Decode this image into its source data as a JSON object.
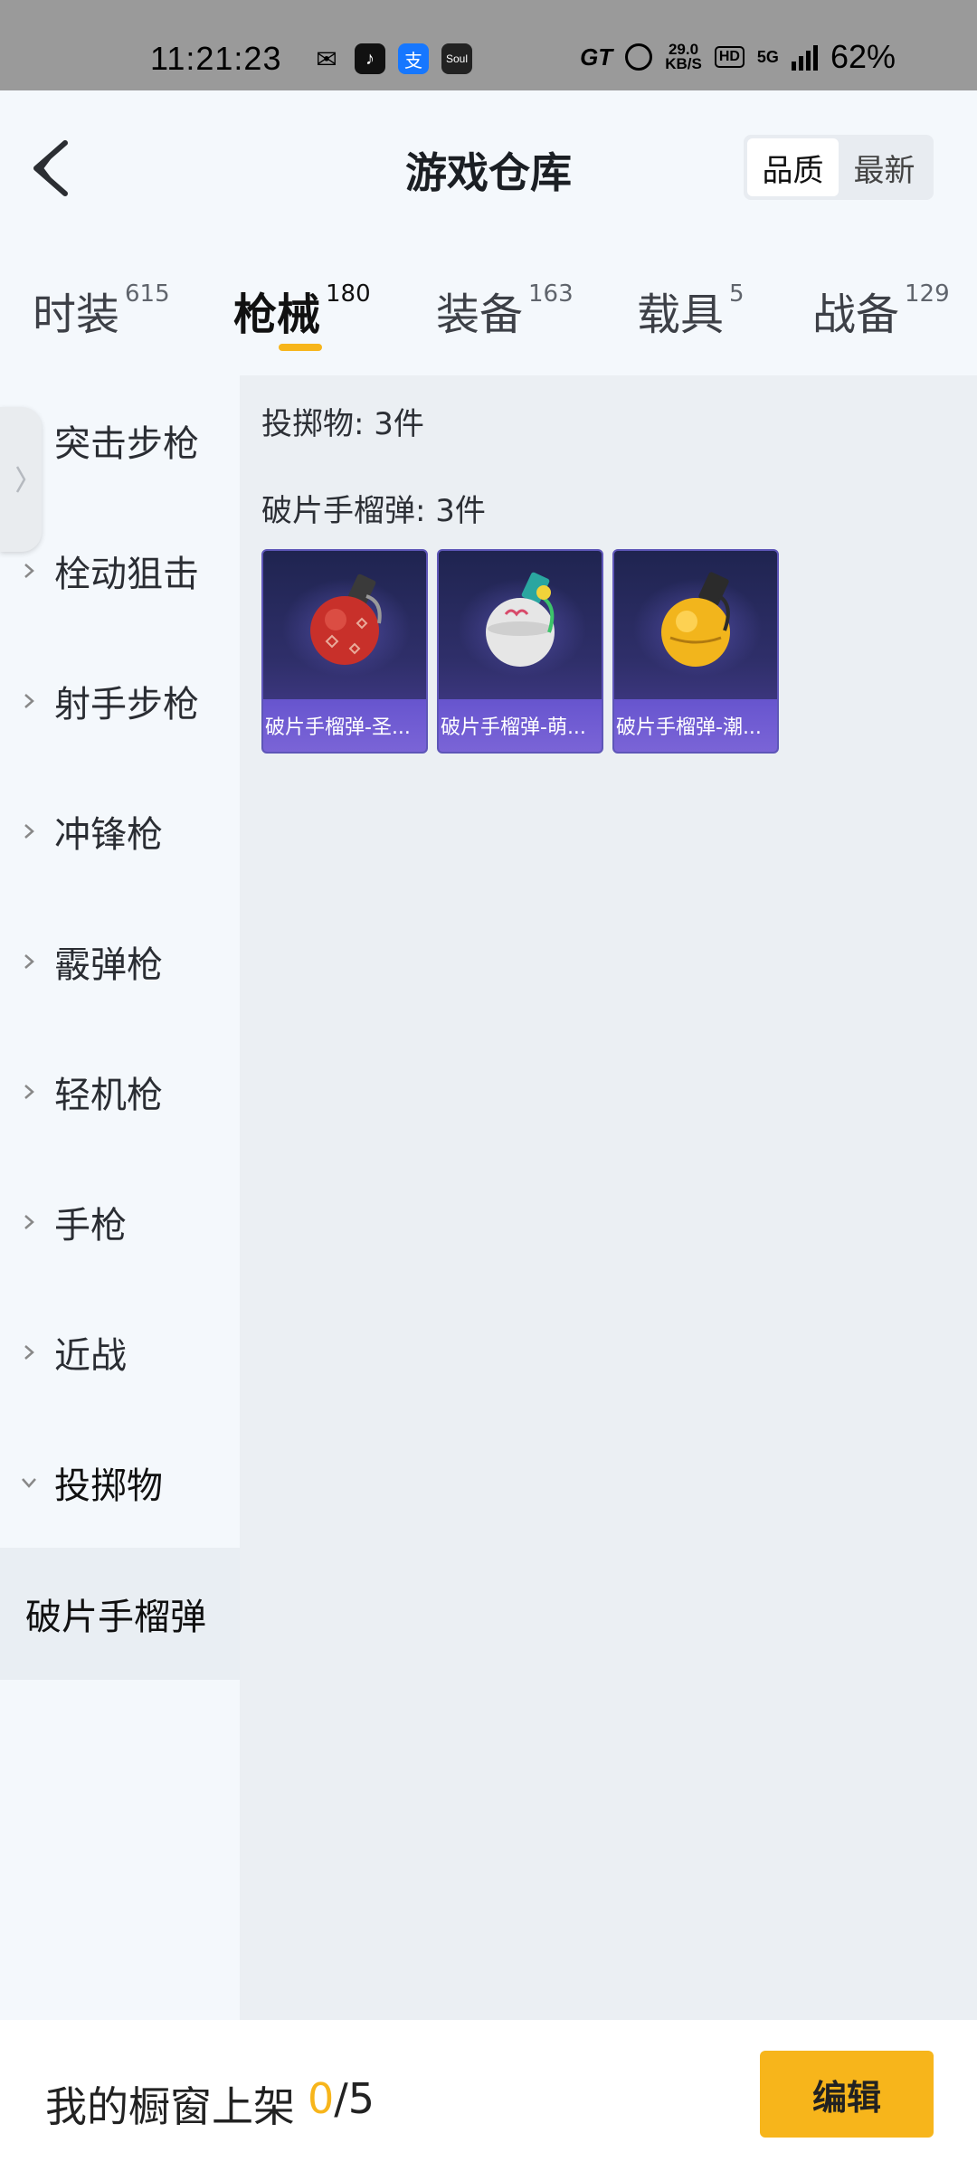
{
  "status_bar": {
    "time": "11:21:23",
    "apps": [
      {
        "icon": "wechat-icon",
        "glyph": "✉"
      },
      {
        "icon": "douyin-icon",
        "glyph": "♪"
      },
      {
        "icon": "alipay-icon",
        "glyph": "支"
      },
      {
        "icon": "soul-icon",
        "glyph": "Soul"
      }
    ],
    "gt_label": "GT",
    "net_speed_value": "29.0",
    "net_speed_unit": "KB/S",
    "hd_label": "HD",
    "network_label": "5G",
    "battery": "62%"
  },
  "header": {
    "title": "游戏仓库",
    "sort_options": [
      "品质",
      "最新"
    ],
    "active_sort": 0
  },
  "tabs": [
    {
      "label": "时装",
      "count": "615"
    },
    {
      "label": "枪械",
      "count": "180"
    },
    {
      "label": "装备",
      "count": "163"
    },
    {
      "label": "载具",
      "count": "5"
    },
    {
      "label": "战备",
      "count": "129"
    }
  ],
  "active_tab": 1,
  "sidebar": {
    "categories": [
      "突击步枪",
      "栓动狙击",
      "射手步枪",
      "冲锋枪",
      "霰弹枪",
      "轻机枪",
      "手枪",
      "近战",
      "投掷物"
    ],
    "expanded_category": "投掷物",
    "subcategory": "破片手榴弹"
  },
  "content": {
    "category_summary": "投掷物: 3件",
    "subcategory_summary": "破片手榴弹: 3件",
    "items": [
      {
        "label": "破片手榴弹-圣...",
        "color": "#c8302a"
      },
      {
        "label": "破片手榴弹-萌...",
        "color": "#e6e6e6"
      },
      {
        "label": "破片手榴弹-潮...",
        "color": "#f2b51c"
      }
    ]
  },
  "bottom_bar": {
    "showcase_label": "我的橱窗上架",
    "showcase_current": "0",
    "showcase_total": "/5",
    "edit_label": "编辑"
  },
  "colors": {
    "accent": "#f7b51b",
    "card_bg": "#2f2f6a"
  }
}
